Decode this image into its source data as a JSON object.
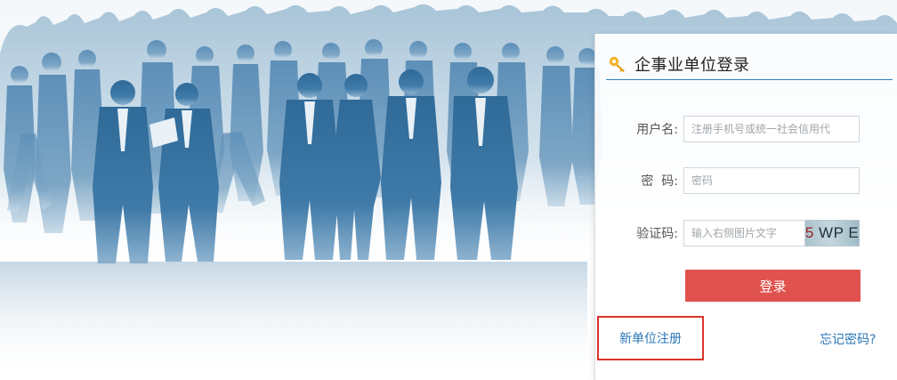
{
  "login": {
    "title": "企事业单位登录",
    "username_label": "用户名:",
    "username_placeholder": "注册手机号或统一社会信用代",
    "password_label": "密  码:",
    "password_placeholder": "密码",
    "captcha_label": "验证码:",
    "captcha_placeholder": "输入右侧图片文字",
    "captcha_text_1": "5",
    "captcha_text_2": " WP E",
    "submit_label": "登录"
  },
  "links": {
    "register": "新单位注册",
    "forgot_password": "忘记密码?"
  },
  "colors": {
    "accent_line": "#2a84c3",
    "button": "#e0524d",
    "link": "#2b77b8",
    "highlight_box": "#d9332c",
    "silhouette": "#3f7aa8"
  },
  "icons": {
    "title_icon": "key-icon",
    "hero": "crowd-silhouette-illustration"
  }
}
